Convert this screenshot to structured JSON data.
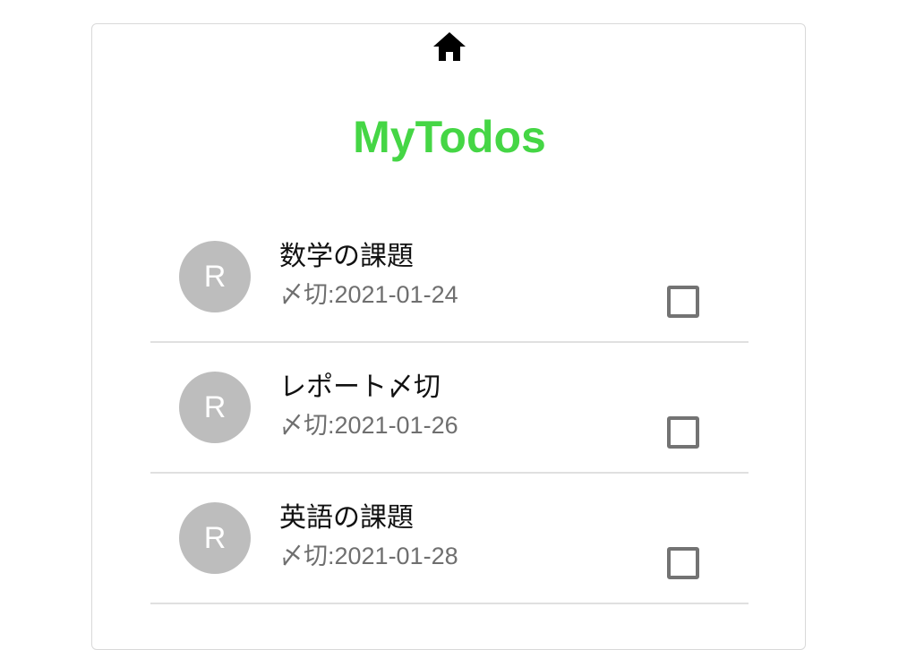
{
  "app": {
    "title": "MyTodos",
    "home_icon": "home-icon",
    "colors": {
      "accent": "#45d645",
      "avatar_background": "#bdbdbd",
      "secondary_text": "#6f6f6f"
    }
  },
  "todos": [
    {
      "avatar_letter": "R",
      "title": "数学の課題",
      "deadline": "〆切:2021-01-24",
      "checked": false
    },
    {
      "avatar_letter": "R",
      "title": "レポート〆切",
      "deadline": "〆切:2021-01-26",
      "checked": false
    },
    {
      "avatar_letter": "R",
      "title": "英語の課題",
      "deadline": "〆切:2021-01-28",
      "checked": false
    }
  ]
}
